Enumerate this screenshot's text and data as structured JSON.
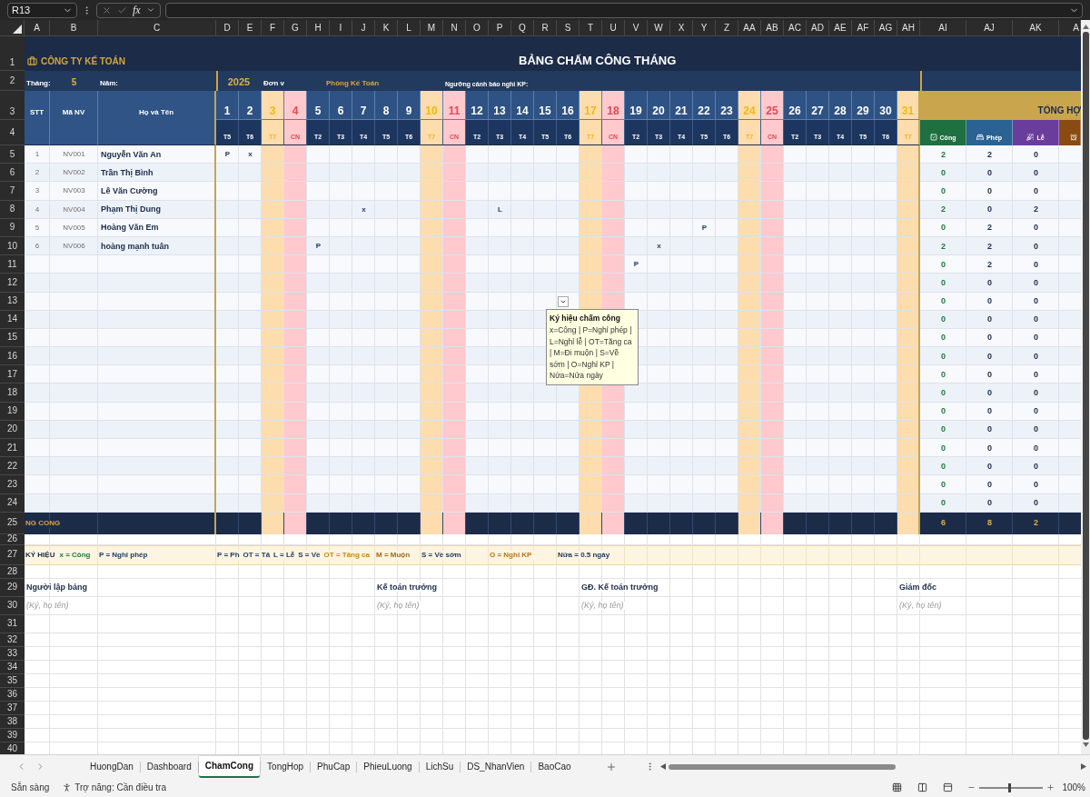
{
  "formula_bar": {
    "name_box": "R13",
    "function_button": "fx"
  },
  "column_headers": [
    "A",
    "B",
    "C",
    "D",
    "E",
    "F",
    "G",
    "H",
    "I",
    "J",
    "K",
    "L",
    "M",
    "N",
    "O",
    "P",
    "Q",
    "R",
    "S",
    "T",
    "U",
    "V",
    "W",
    "X",
    "Y",
    "Z",
    "AA",
    "AB",
    "AC",
    "AD",
    "AE",
    "AF",
    "AG",
    "AH",
    "AI",
    "AJ",
    "AK",
    "A"
  ],
  "row_numbers": [
    "1",
    "2",
    "3",
    "4",
    "5",
    "6",
    "7",
    "8",
    "9",
    "10",
    "11",
    "12",
    "13",
    "14",
    "15",
    "16",
    "17",
    "18",
    "19",
    "20",
    "21",
    "22",
    "23",
    "24",
    "25",
    "26",
    "27",
    "28",
    "29",
    "30",
    "31",
    "32",
    "33",
    "34",
    "35",
    "36",
    "37",
    "38",
    "39",
    "40"
  ],
  "sheet": {
    "company": "CÔNG TY KẾ TOÁN",
    "title": "BẢNG CHẤM CÔNG THÁNG",
    "info": {
      "month_label": "Tháng:",
      "month": "5",
      "year_label": "Năm:",
      "year": "2025",
      "unit_label": "Đơn v",
      "unit": "Phòng Kế Toán",
      "threshold_label": "Ngưỡng cảnh báo nghỉ KP:"
    },
    "headers": [
      "STT",
      "Mã NV",
      "Họ và Tên"
    ],
    "days": [
      {
        "day": "1",
        "weekday": "T5",
        "kind": "weekday"
      },
      {
        "day": "2",
        "weekday": "T6",
        "kind": "weekday"
      },
      {
        "day": "3",
        "weekday": "T7",
        "kind": "saturday"
      },
      {
        "day": "4",
        "weekday": "CN",
        "kind": "sunday"
      },
      {
        "day": "5",
        "weekday": "T2",
        "kind": "weekday"
      },
      {
        "day": "6",
        "weekday": "T3",
        "kind": "weekday"
      },
      {
        "day": "7",
        "weekday": "T4",
        "kind": "weekday"
      },
      {
        "day": "8",
        "weekday": "T5",
        "kind": "weekday"
      },
      {
        "day": "9",
        "weekday": "T6",
        "kind": "weekday"
      },
      {
        "day": "10",
        "weekday": "T7",
        "kind": "saturday"
      },
      {
        "day": "11",
        "weekday": "CN",
        "kind": "sunday"
      },
      {
        "day": "12",
        "weekday": "T2",
        "kind": "weekday"
      },
      {
        "day": "13",
        "weekday": "T3",
        "kind": "weekday"
      },
      {
        "day": "14",
        "weekday": "T4",
        "kind": "weekday"
      },
      {
        "day": "15",
        "weekday": "T5",
        "kind": "weekday"
      },
      {
        "day": "16",
        "weekday": "T6",
        "kind": "weekday"
      },
      {
        "day": "17",
        "weekday": "T7",
        "kind": "saturday"
      },
      {
        "day": "18",
        "weekday": "CN",
        "kind": "sunday"
      },
      {
        "day": "19",
        "weekday": "T2",
        "kind": "weekday"
      },
      {
        "day": "20",
        "weekday": "T3",
        "kind": "weekday"
      },
      {
        "day": "21",
        "weekday": "T4",
        "kind": "weekday"
      },
      {
        "day": "22",
        "weekday": "T5",
        "kind": "weekday"
      },
      {
        "day": "23",
        "weekday": "T6",
        "kind": "weekday"
      },
      {
        "day": "24",
        "weekday": "T7",
        "kind": "saturday"
      },
      {
        "day": "25",
        "weekday": "CN",
        "kind": "sunday"
      },
      {
        "day": "26",
        "weekday": "T2",
        "kind": "weekday"
      },
      {
        "day": "27",
        "weekday": "T3",
        "kind": "weekday"
      },
      {
        "day": "28",
        "weekday": "T4",
        "kind": "weekday"
      },
      {
        "day": "29",
        "weekday": "T5",
        "kind": "weekday"
      },
      {
        "day": "30",
        "weekday": "T6",
        "kind": "weekday"
      },
      {
        "day": "31",
        "weekday": "T7",
        "kind": "saturday"
      }
    ],
    "summary": {
      "title": "TỔNG HỢ",
      "columns": [
        {
          "label": "Công",
          "color": "#1f7040"
        },
        {
          "label": "Phép",
          "color": "#2a6293"
        },
        {
          "label": "Lễ",
          "color": "#6a3d9c"
        },
        {
          "color": "#8a4b12"
        }
      ]
    },
    "rows": [
      {
        "stt": "1",
        "code": "NV001",
        "name": "Nguyễn Văn An",
        "marks": {
          "1": "P",
          "2": "x"
        },
        "totals": [
          "2",
          "2",
          "0"
        ]
      },
      {
        "stt": "2",
        "code": "NV002",
        "name": "Trần Thị Bình",
        "totals": [
          "0",
          "0",
          "0"
        ]
      },
      {
        "stt": "3",
        "code": "NV003",
        "name": "Lê Văn Cường",
        "totals": [
          "0",
          "0",
          "0"
        ]
      },
      {
        "stt": "4",
        "code": "NV004",
        "name": "Phạm Thị Dung",
        "marks": {
          "7": "x",
          "13": "L"
        },
        "totals": [
          "2",
          "0",
          "2"
        ]
      },
      {
        "stt": "5",
        "code": "NV005",
        "name": "Hoàng Văn Em",
        "marks": {
          "22": "P"
        },
        "totals": [
          "0",
          "2",
          "0"
        ]
      },
      {
        "stt": "6",
        "code": "NV006",
        "name": "hoàng mạnh tuân",
        "marks": {
          "5": "P",
          "20": "x"
        },
        "totals": [
          "2",
          "2",
          "0"
        ]
      },
      {
        "marks": {
          "19": "P"
        },
        "totals": [
          "0",
          "2",
          "0"
        ]
      },
      {
        "totals": [
          "0",
          "0",
          "0"
        ]
      },
      {
        "totals": [
          "0",
          "0",
          "0"
        ]
      },
      {
        "totals": [
          "0",
          "0",
          "0"
        ]
      },
      {
        "totals": [
          "0",
          "0",
          "0"
        ]
      },
      {
        "totals": [
          "0",
          "0",
          "0"
        ]
      },
      {
        "totals": [
          "0",
          "0",
          "0"
        ]
      },
      {
        "totals": [
          "0",
          "0",
          "0"
        ]
      },
      {
        "totals": [
          "0",
          "0",
          "0"
        ]
      },
      {
        "totals": [
          "0",
          "0",
          "0"
        ]
      },
      {
        "totals": [
          "0",
          "0",
          "0"
        ]
      },
      {
        "totals": [
          "0",
          "0",
          "0"
        ]
      },
      {
        "totals": [
          "0",
          "0",
          "0"
        ]
      },
      {
        "totals": [
          "0",
          "0",
          "0"
        ]
      }
    ],
    "total_row": {
      "label": "NG CONG",
      "totals": [
        "6",
        "8",
        "2"
      ]
    },
    "legend": {
      "title": "KÝ HIỆU",
      "items": [
        {
          "text": "x = Công",
          "color": "#1f7a3e"
        },
        {
          "text": "P = Nghỉ phép",
          "color": "#1f3a66"
        },
        {
          "text": "P = Ph",
          "color": "#1f3a66"
        },
        {
          "text": "OT = Tă",
          "color": "#1f3a66"
        },
        {
          "text": "L = Lễ",
          "color": "#1f3a66"
        },
        {
          "text": "S = Về",
          "color": "#1f3a66"
        },
        {
          "text": "OT = Tăng ca",
          "color": "#c8861a"
        },
        {
          "text": "M = Muộn",
          "color": "#9c6a1c"
        },
        {
          "text": "S = Về sớm",
          "color": "#1f3a66"
        },
        {
          "text": "O = Nghỉ KP",
          "color": "#b8741a"
        },
        {
          "text": "Nửa = 0.5 ngày",
          "color": "#1f3a66"
        }
      ]
    },
    "signatures": [
      {
        "title": "Người lập bảng",
        "hint": "(Ký, họ tên)"
      },
      {
        "title": "Kế toán trưởng",
        "hint": "(Ký, họ tên)"
      },
      {
        "title": "GĐ. Kế toán trưởng",
        "hint": "(Ký, họ tên)"
      },
      {
        "title": "Giám đốc",
        "hint": "(Ký, họ tên)"
      }
    ]
  },
  "tooltip": {
    "title": "Ký hiệu chấm công",
    "body": "x=Công | P=Nghỉ phép | L=Nghỉ lễ | OT=Tăng ca | M=Đi muộn | S=Về sớm | O=Nghỉ KP | Nửa=Nửa ngày"
  },
  "sheet_tabs": [
    {
      "label": "HuongDan",
      "selected": false
    },
    {
      "label": "Dashboard",
      "selected": false
    },
    {
      "label": "ChamCong",
      "selected": true
    },
    {
      "label": "TongHop",
      "selected": false
    },
    {
      "label": "PhuCap",
      "selected": false
    },
    {
      "label": "PhieuLuong",
      "selected": false
    },
    {
      "label": "LichSu",
      "selected": false
    },
    {
      "label": "DS_NhanVien",
      "selected": false
    },
    {
      "label": "BaoCao",
      "selected": false
    }
  ],
  "status_bar": {
    "state": "Sẵn sàng",
    "accessibility": "Trợ năng: Cần điều tra",
    "zoom_slider": {
      "level": 0.45
    },
    "zoom": "100%"
  }
}
